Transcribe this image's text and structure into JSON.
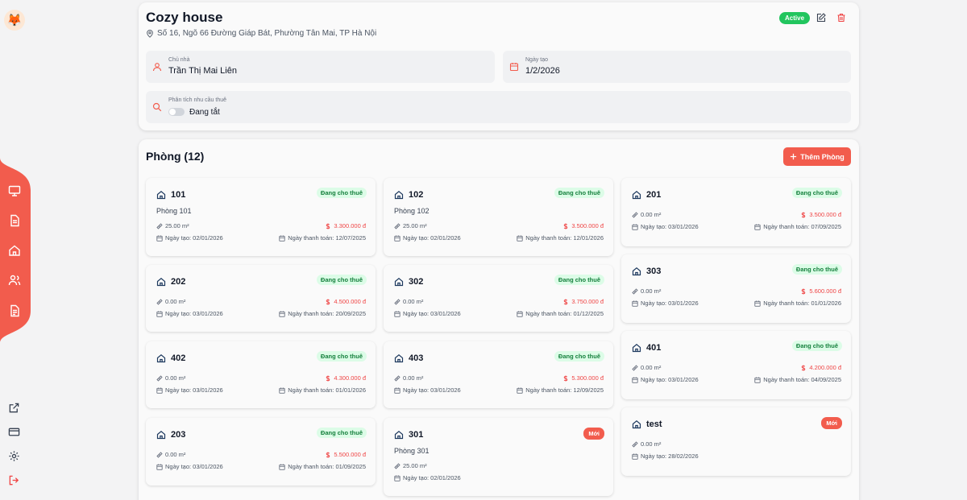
{
  "house": {
    "title": "Cozy house",
    "address": "Số 16, Ngõ 66 Đường Giáp Bát, Phường Tân Mai, TP Hà Nội",
    "status": "Active",
    "owner_label": "Chủ nhà",
    "owner": "Trần Thị Mai Liên",
    "created_label": "Ngày tạo",
    "created": "1/2/2026",
    "analysis_label": "Phân tích nhu cầu thuê",
    "analysis_state": "Đang tắt"
  },
  "rooms_section": {
    "title": "Phòng (12)",
    "add_label": "Thêm Phòng"
  },
  "colors": {
    "accent": "#f25c4d",
    "active": "#22c55e",
    "rented_bg": "#dcfce7",
    "rented_text": "#15803d",
    "price": "#ef4444"
  },
  "rooms": [
    {
      "name": "101",
      "badge": "Đang cho thuê",
      "desc": "Phòng 101",
      "area": "25.00 m²",
      "price": "3.300.000 đ",
      "created": "Ngày tạo: 02/01/2026",
      "payment": "Ngày thanh toán: 12/07/2025"
    },
    {
      "name": "102",
      "badge": "Đang cho thuê",
      "desc": "Phòng 102",
      "area": "25.00 m²",
      "price": "3.500.000 đ",
      "created": "Ngày tạo: 02/01/2026",
      "payment": "Ngày thanh toán: 12/01/2026"
    },
    {
      "name": "201",
      "badge": "Đang cho thuê",
      "area": "0.00 m²",
      "price": "3.500.000 đ",
      "created": "Ngày tạo: 03/01/2026",
      "payment": "Ngày thanh toán: 07/09/2025"
    },
    {
      "name": "202",
      "badge": "Đang cho thuê",
      "area": "0.00 m²",
      "price": "4.500.000 đ",
      "created": "Ngày tạo: 03/01/2026",
      "payment": "Ngày thanh toán: 20/09/2025"
    },
    {
      "name": "302",
      "badge": "Đang cho thuê",
      "area": "0.00 m²",
      "price": "3.750.000 đ",
      "created": "Ngày tạo: 03/01/2026",
      "payment": "Ngày thanh toán: 01/12/2025"
    },
    {
      "name": "303",
      "badge": "Đang cho thuê",
      "area": "0.00 m²",
      "price": "5.600.000 đ",
      "created": "Ngày tạo: 03/01/2026",
      "payment": "Ngày thanh toán: 01/01/2026"
    },
    {
      "name": "402",
      "badge": "Đang cho thuê",
      "area": "0.00 m²",
      "price": "4.300.000 đ",
      "created": "Ngày tạo: 03/01/2026",
      "payment": "Ngày thanh toán: 01/01/2026"
    },
    {
      "name": "403",
      "badge": "Đang cho thuê",
      "area": "0.00 m²",
      "price": "5.300.000 đ",
      "created": "Ngày tạo: 03/01/2026",
      "payment": "Ngày thanh toán: 12/09/2025"
    },
    {
      "name": "401",
      "badge": "Đang cho thuê",
      "area": "0.00 m²",
      "price": "4.200.000 đ",
      "created": "Ngày tạo: 03/01/2026",
      "payment": "Ngày thanh toán: 04/09/2025"
    },
    {
      "name": "203",
      "badge": "Đang cho thuê",
      "area": "0.00 m²",
      "price": "5.500.000 đ",
      "created": "Ngày tạo: 03/01/2026",
      "payment": "Ngày thanh toán: 01/09/2025"
    },
    {
      "name": "301",
      "badge": "Mới",
      "desc": "Phòng 301",
      "area": "25.00 m²",
      "created": "Ngày tạo: 02/01/2026"
    },
    {
      "name": "test",
      "badge": "Mới",
      "area": "0.00 m²",
      "created": "Ngày tạo: 28/02/2026"
    }
  ]
}
